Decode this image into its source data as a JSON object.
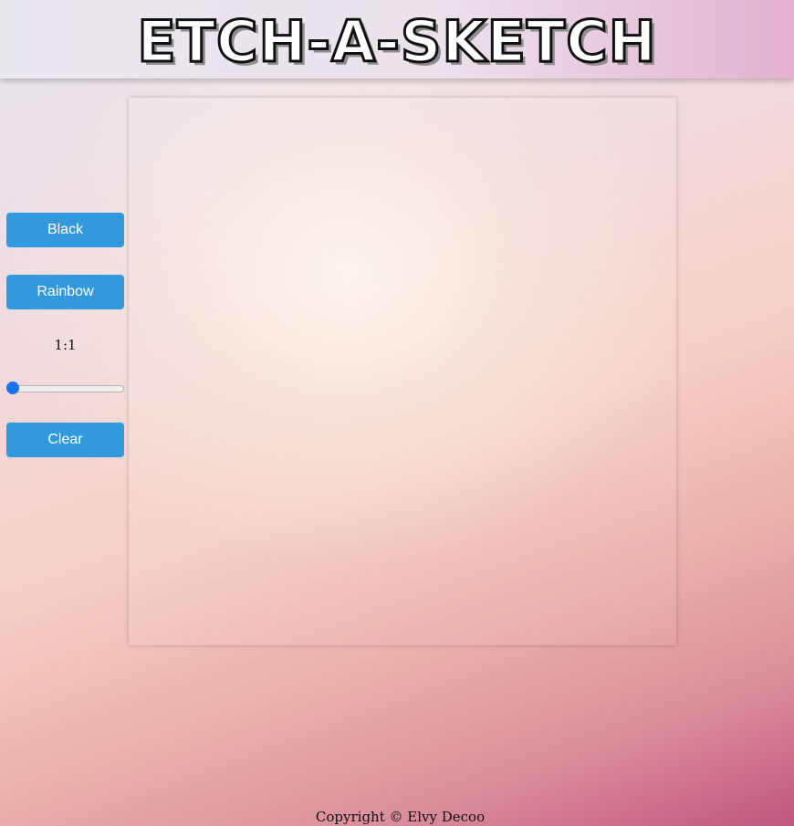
{
  "header": {
    "title": "ETCH-A-SKETCH"
  },
  "controls": {
    "black_label": "Black",
    "rainbow_label": "Rainbow",
    "grid_size_label": "1:1",
    "grid_size_slider_value": 0,
    "clear_label": "Clear",
    "button_color": "#3399dd",
    "slider_thumb_color": "#1a73e8"
  },
  "footer": {
    "copyright": "Copyright © Elvy Decoo"
  }
}
